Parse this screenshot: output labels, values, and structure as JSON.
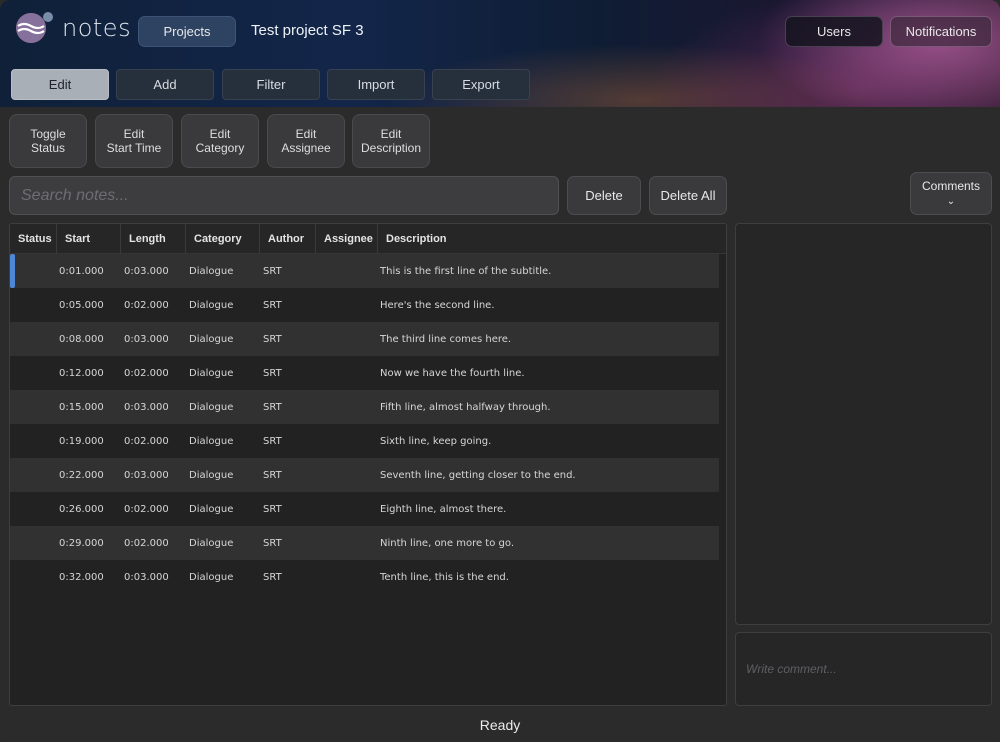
{
  "app": {
    "name": "notes",
    "project_title": "Test project SF 3",
    "colors": {
      "accent": "#4e86d8",
      "active_tab": "#a9afb6",
      "background": "#2b2b2c"
    }
  },
  "header": {
    "projects_label": "Projects",
    "users_label": "Users",
    "notifications_label": "Notifications"
  },
  "tabs": [
    {
      "label": "Edit",
      "active": true
    },
    {
      "label": "Add",
      "active": false
    },
    {
      "label": "Filter",
      "active": false
    },
    {
      "label": "Import",
      "active": false
    },
    {
      "label": "Export",
      "active": false
    }
  ],
  "toolbar": [
    {
      "line1": "Toggle",
      "line2": "Status"
    },
    {
      "line1": "Edit",
      "line2": "Start Time"
    },
    {
      "line1": "Edit",
      "line2": "Category"
    },
    {
      "line1": "Edit",
      "line2": "Assignee"
    },
    {
      "line1": "Edit",
      "line2": "Description"
    }
  ],
  "search": {
    "placeholder": "Search notes..."
  },
  "actions": {
    "delete_label": "Delete",
    "delete_all_label": "Delete All",
    "comments_label": "Comments",
    "comments_icon": "chevron-down-icon"
  },
  "table": {
    "columns": [
      "Status",
      "Start",
      "Length",
      "Category",
      "Author",
      "Assignee",
      "Description"
    ],
    "rows": [
      {
        "status": "",
        "start": "0:01.000",
        "length": "0:03.000",
        "category": "Dialogue",
        "author": "SRT",
        "assignee": "",
        "description": "This is the first line of the subtitle.",
        "selected": true
      },
      {
        "status": "",
        "start": "0:05.000",
        "length": "0:02.000",
        "category": "Dialogue",
        "author": "SRT",
        "assignee": "",
        "description": "Here's the second line."
      },
      {
        "status": "",
        "start": "0:08.000",
        "length": "0:03.000",
        "category": "Dialogue",
        "author": "SRT",
        "assignee": "",
        "description": "The third line comes here."
      },
      {
        "status": "",
        "start": "0:12.000",
        "length": "0:02.000",
        "category": "Dialogue",
        "author": "SRT",
        "assignee": "",
        "description": "Now we have the fourth line."
      },
      {
        "status": "",
        "start": "0:15.000",
        "length": "0:03.000",
        "category": "Dialogue",
        "author": "SRT",
        "assignee": "",
        "description": "Fifth line, almost halfway through."
      },
      {
        "status": "",
        "start": "0:19.000",
        "length": "0:02.000",
        "category": "Dialogue",
        "author": "SRT",
        "assignee": "",
        "description": "Sixth line, keep going."
      },
      {
        "status": "",
        "start": "0:22.000",
        "length": "0:03.000",
        "category": "Dialogue",
        "author": "SRT",
        "assignee": "",
        "description": "Seventh line, getting closer to the end."
      },
      {
        "status": "",
        "start": "0:26.000",
        "length": "0:02.000",
        "category": "Dialogue",
        "author": "SRT",
        "assignee": "",
        "description": "Eighth line, almost there."
      },
      {
        "status": "",
        "start": "0:29.000",
        "length": "0:02.000",
        "category": "Dialogue",
        "author": "SRT",
        "assignee": "",
        "description": "Ninth line, one more to go."
      },
      {
        "status": "",
        "start": "0:32.000",
        "length": "0:03.000",
        "category": "Dialogue",
        "author": "SRT",
        "assignee": "",
        "description": "Tenth line, this is the end."
      }
    ]
  },
  "comment": {
    "placeholder": "Write comment..."
  },
  "statusbar": {
    "text": "Ready"
  }
}
